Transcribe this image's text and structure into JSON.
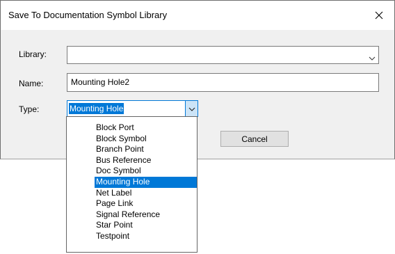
{
  "dialog": {
    "title": "Save To Documentation Symbol Library",
    "close_icon": "close-icon"
  },
  "form": {
    "library_label": "Library:",
    "library_value": "",
    "name_label": "Name:",
    "name_value": "Mounting Hole2",
    "type_label": "Type:",
    "type_value": "Mounting Hole"
  },
  "buttons": {
    "cancel_label": "Cancel"
  },
  "type_options": [
    "Block Port",
    "Block Symbol",
    "Branch Point",
    "Bus Reference",
    "Doc Symbol",
    "Mounting Hole",
    "Net Label",
    "Page Link",
    "Signal Reference",
    "Star Point",
    "Testpoint"
  ],
  "selected_option": "Mounting Hole",
  "colors": {
    "accent": "#0078d7",
    "dialog_bg": "#f0f0f0",
    "titlebar_bg": "#ffffff"
  }
}
